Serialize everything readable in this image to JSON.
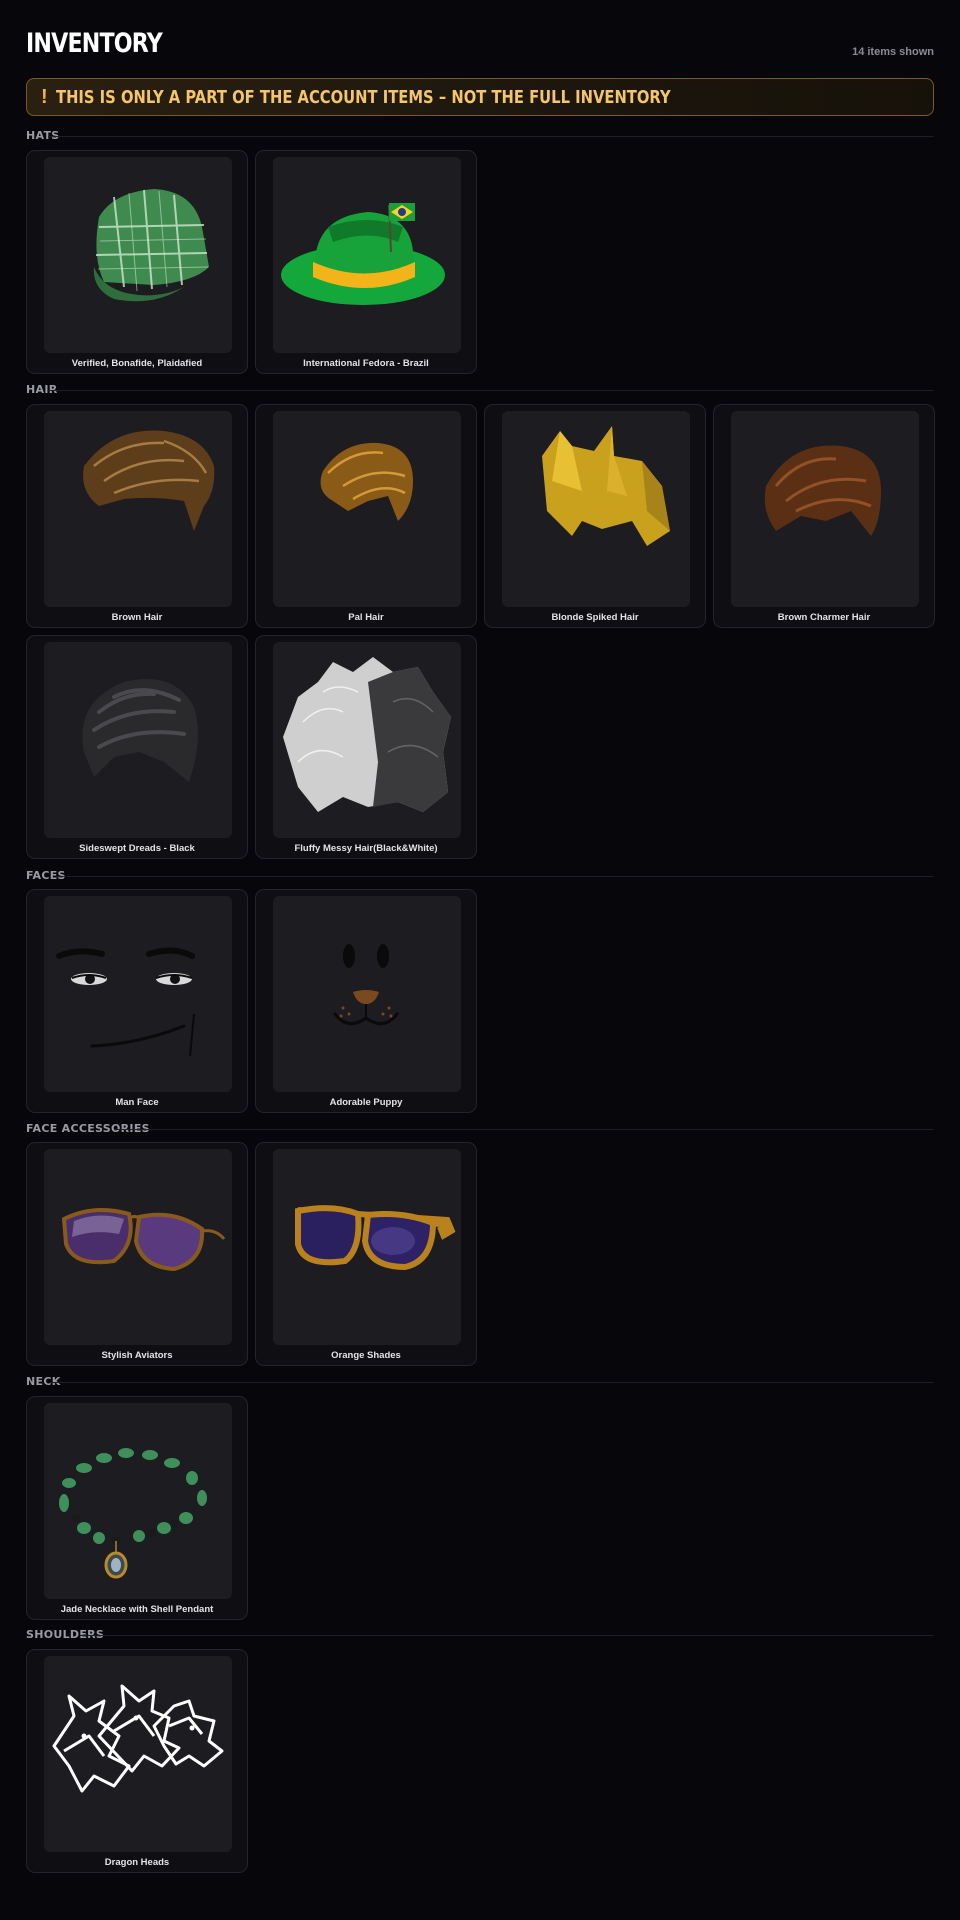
{
  "header": {
    "title": "INVENTORY",
    "count": "14 items shown"
  },
  "notice": {
    "icon": "!",
    "text": "THIS IS ONLY A PART OF THE ACCOUNT ITEMS – NOT THE FULL INVENTORY"
  },
  "sections": {
    "hats": {
      "label": "HATS",
      "items": [
        {
          "name": "Verified, Bonafide, Plaidafied",
          "icon": "plaid-cap-icon"
        },
        {
          "name": "International Fedora - Brazil",
          "icon": "brazil-fedora-icon"
        }
      ]
    },
    "hair": {
      "label": "HAIR",
      "items": [
        {
          "name": "Brown Hair",
          "icon": "brown-hair-icon"
        },
        {
          "name": "Pal Hair",
          "icon": "pal-hair-icon"
        },
        {
          "name": "Blonde Spiked Hair",
          "icon": "blonde-spiked-hair-icon"
        },
        {
          "name": "Brown Charmer Hair",
          "icon": "brown-charmer-hair-icon"
        },
        {
          "name": "Sideswept Dreads - Black",
          "icon": "dreads-hair-icon"
        },
        {
          "name": "Fluffy Messy Hair(Black&White)",
          "icon": "fluffy-hair-icon"
        }
      ]
    },
    "faces": {
      "label": "FACES",
      "items": [
        {
          "name": "Man Face",
          "icon": "man-face-icon"
        },
        {
          "name": "Adorable Puppy",
          "icon": "puppy-face-icon"
        }
      ]
    },
    "face_accessories": {
      "label": "FACE ACCESSORIES",
      "items": [
        {
          "name": "Stylish Aviators",
          "icon": "aviators-icon"
        },
        {
          "name": "Orange Shades",
          "icon": "orange-shades-icon"
        }
      ]
    },
    "neck": {
      "label": "NECK",
      "items": [
        {
          "name": "Jade Necklace with Shell Pendant",
          "icon": "jade-necklace-icon"
        }
      ]
    },
    "shoulders": {
      "label": "SHOULDERS",
      "items": [
        {
          "name": "Dragon Heads",
          "icon": "dragon-heads-icon"
        }
      ]
    }
  }
}
